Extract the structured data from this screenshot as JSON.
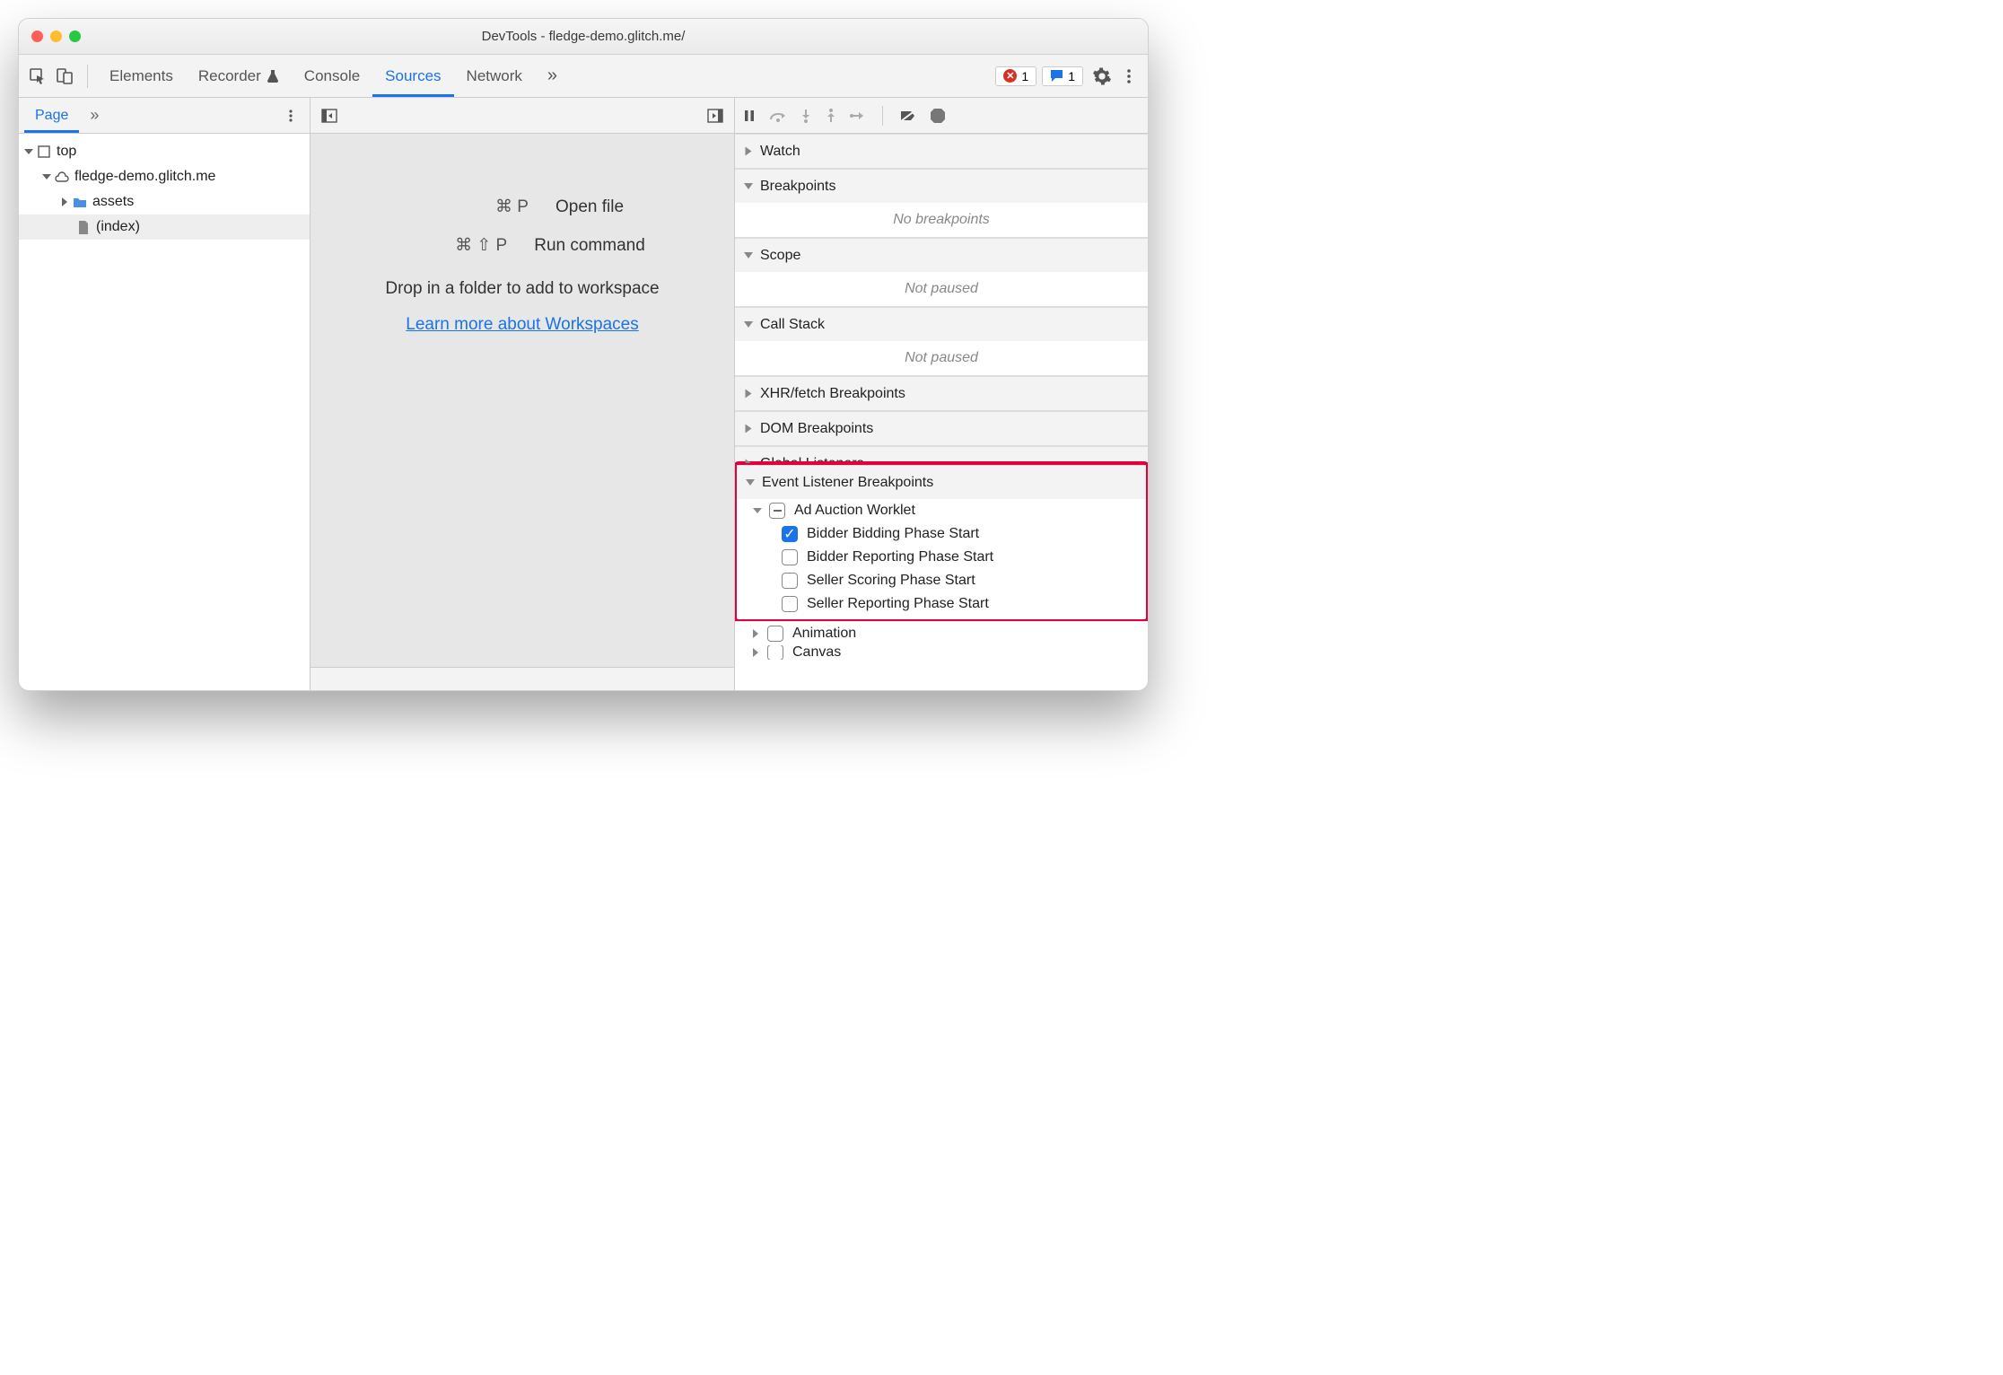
{
  "window": {
    "title": "DevTools - fledge-demo.glitch.me/"
  },
  "toolbar": {
    "tabs": [
      "Elements",
      "Recorder",
      "Console",
      "Sources",
      "Network"
    ],
    "active": "Sources",
    "more": "»",
    "error_count": "1",
    "message_count": "1"
  },
  "left": {
    "tab": "Page",
    "more": "»",
    "tree": {
      "top": "top",
      "origin": "fledge-demo.glitch.me",
      "folder": "assets",
      "file": "(index)"
    }
  },
  "mid": {
    "open_shortcut": "⌘ P",
    "open_label": "Open file",
    "run_shortcut": "⌘ ⇧ P",
    "run_label": "Run command",
    "drop_text": "Drop in a folder to add to workspace",
    "learn_link": "Learn more about Workspaces"
  },
  "right": {
    "sections": {
      "watch": "Watch",
      "breakpoints": "Breakpoints",
      "breakpoints_empty": "No breakpoints",
      "scope": "Scope",
      "scope_empty": "Not paused",
      "callstack": "Call Stack",
      "callstack_empty": "Not paused",
      "xhr": "XHR/fetch Breakpoints",
      "dom": "DOM Breakpoints",
      "global": "Global Listeners",
      "elb": "Event Listener Breakpoints",
      "adworklet": "Ad Auction Worklet",
      "ad_items": [
        "Bidder Bidding Phase Start",
        "Bidder Reporting Phase Start",
        "Seller Scoring Phase Start",
        "Seller Reporting Phase Start"
      ],
      "animation": "Animation",
      "canvas": "Canvas"
    }
  }
}
